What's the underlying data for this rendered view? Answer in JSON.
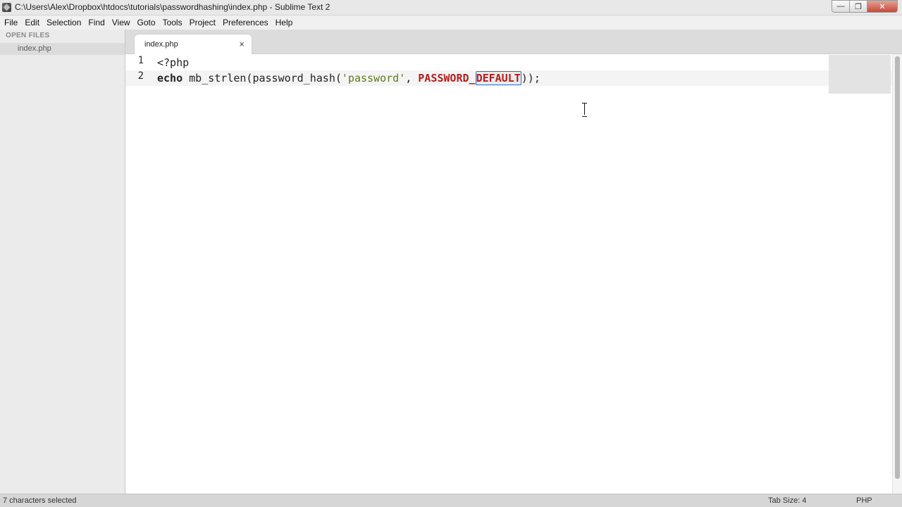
{
  "window": {
    "title": "C:\\Users\\Alex\\Dropbox\\htdocs\\tutorials\\passwordhashing\\index.php - Sublime Text 2",
    "minimize": "—",
    "maximize": "❐",
    "close": "✕"
  },
  "menu": [
    "File",
    "Edit",
    "Selection",
    "Find",
    "View",
    "Goto",
    "Tools",
    "Project",
    "Preferences",
    "Help"
  ],
  "sidebar": {
    "header": "OPEN FILES",
    "files": [
      "index.php"
    ]
  },
  "tabs": [
    {
      "label": "index.php",
      "close": "×"
    }
  ],
  "editor": {
    "line_numbers": [
      "1",
      "2"
    ],
    "line1": "<?php",
    "line2": {
      "kw_echo": "echo",
      "fn": " mb_strlen(password_hash(",
      "str": "'password'",
      "comma": ", ",
      "const_prefix": "PASSWORD_",
      "const_selected": "DEFAULT",
      "tail": "));"
    },
    "colors": {
      "string": "#5c7a1f",
      "constant": "#b0201d",
      "selection": "#2b6fd6"
    }
  },
  "status": {
    "left": "7 characters selected",
    "tab_size": "Tab Size: 4",
    "syntax": "PHP"
  }
}
